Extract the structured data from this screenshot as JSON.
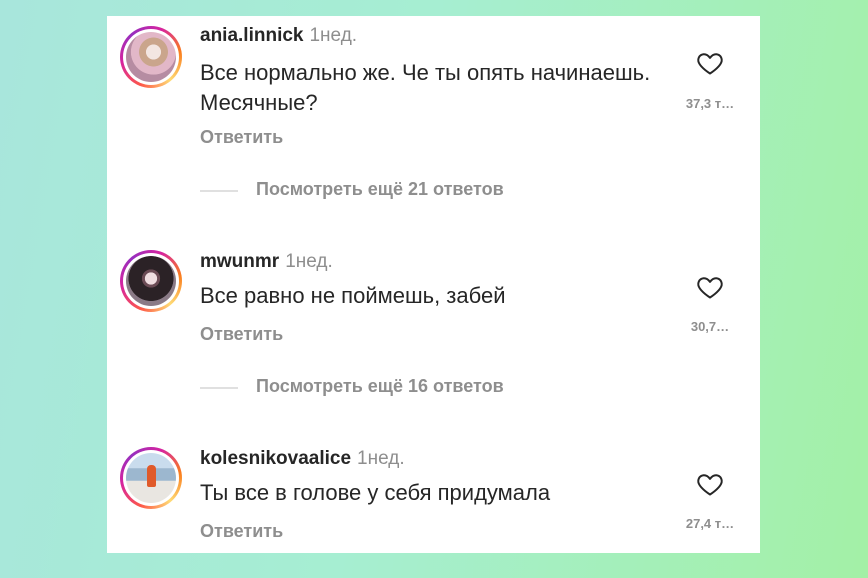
{
  "comments": [
    {
      "username": "ania.linnick",
      "time": "1нед.",
      "text": "Все нормально же. Че ты опять начинаешь. Месячные?",
      "reply_label": "Ответить",
      "likes": "37,3 т…",
      "more_replies": "Посмотреть ещё 21 ответов"
    },
    {
      "username": "mwunmr",
      "time": "1нед.",
      "text": "Все равно не поймешь, забей",
      "reply_label": "Ответить",
      "likes": "30,7…",
      "more_replies": "Посмотреть ещё 16 ответов"
    },
    {
      "username": "kolesnikovaalice",
      "time": "1нед.",
      "text": "Ты все в голове у себя придумала",
      "reply_label": "Ответить",
      "likes": "27,4 т…"
    }
  ],
  "icons": {
    "like": "heart-outline-icon"
  },
  "colors": {
    "text_primary": "#262626",
    "text_secondary": "#8e8e8e",
    "background_gradient_start": "#a8e6dc",
    "background_gradient_end": "#a3f0a6"
  }
}
